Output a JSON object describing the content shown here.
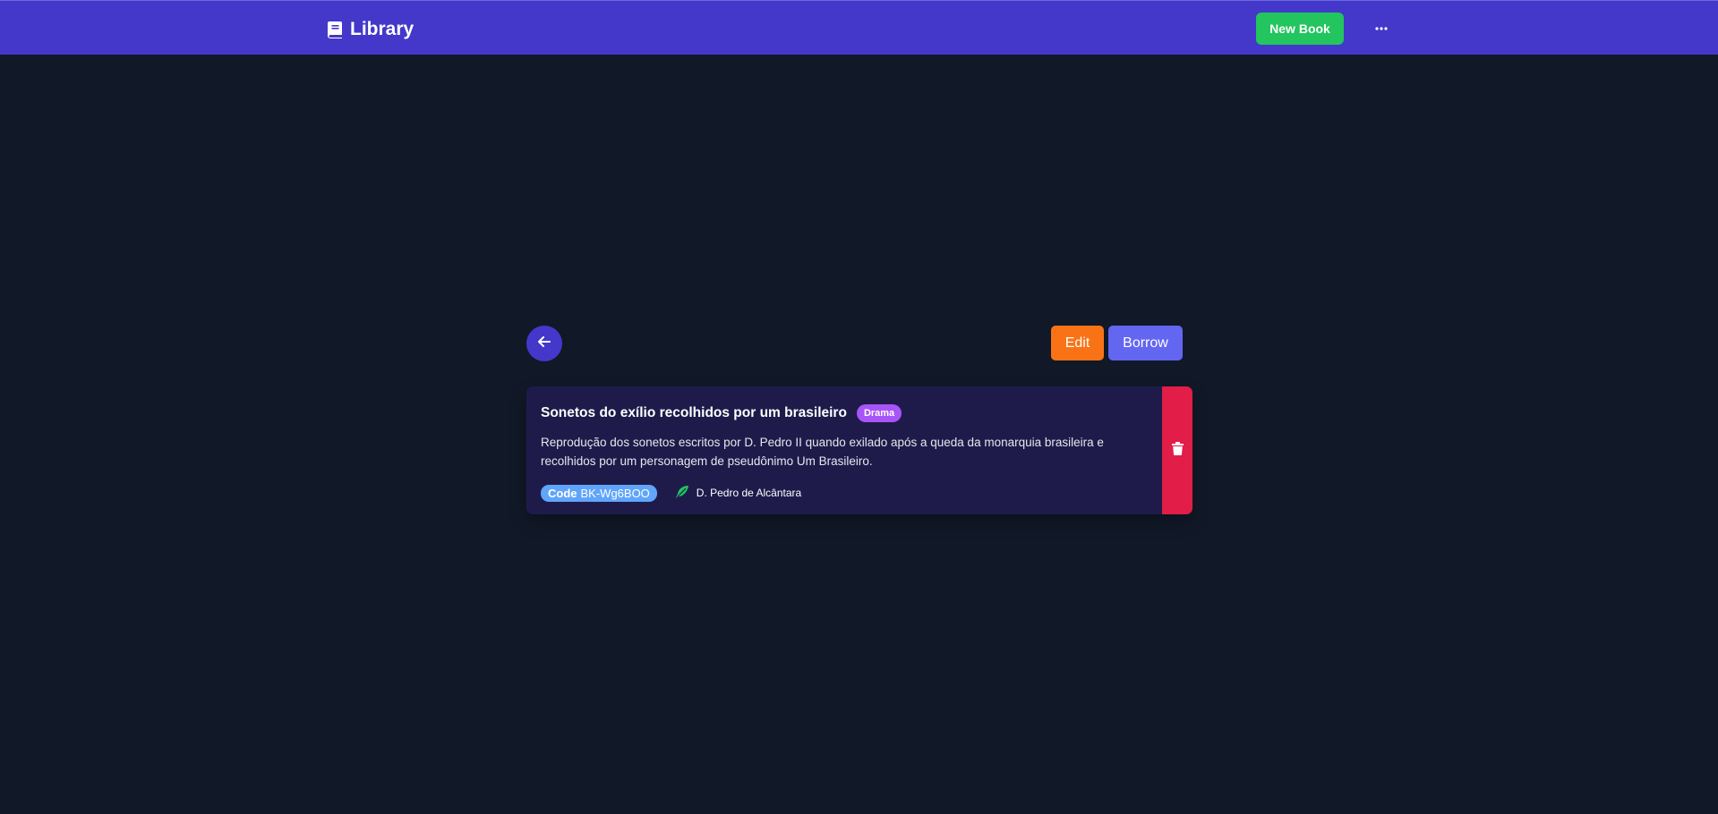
{
  "navbar": {
    "brand_icon": "book-icon",
    "brand_label": "Library",
    "new_book_label": "New Book",
    "more_icon": "ellipsis-icon",
    "colors": {
      "background": "#4338ca",
      "new_book": "#22c55e"
    }
  },
  "actions": {
    "back_icon": "arrow-left-icon",
    "edit_label": "Edit",
    "borrow_label": "Borrow",
    "colors": {
      "edit": "#f97316",
      "borrow": "#6366f1",
      "back": "#4338ca"
    }
  },
  "book": {
    "title": "Sonetos do exílio recolhidos por um brasileiro",
    "genre": "Drama",
    "description": "Reprodução dos sonetos escritos por D. Pedro II quando exilado após a queda da monarquia brasileira e recolhidos por um personagem de pseudônimo Um Brasileiro.",
    "code_label": "Code",
    "code_value": "BK-Wg6BOO",
    "author_icon": "feather-icon",
    "author": "D. Pedro de Alcântara",
    "delete_icon": "trash-icon",
    "colors": {
      "card": "#1e1b4b",
      "genre": "#a855f7",
      "code": "#60a5fa",
      "author_icon": "#22c55e",
      "delete": "#e11d48"
    }
  }
}
